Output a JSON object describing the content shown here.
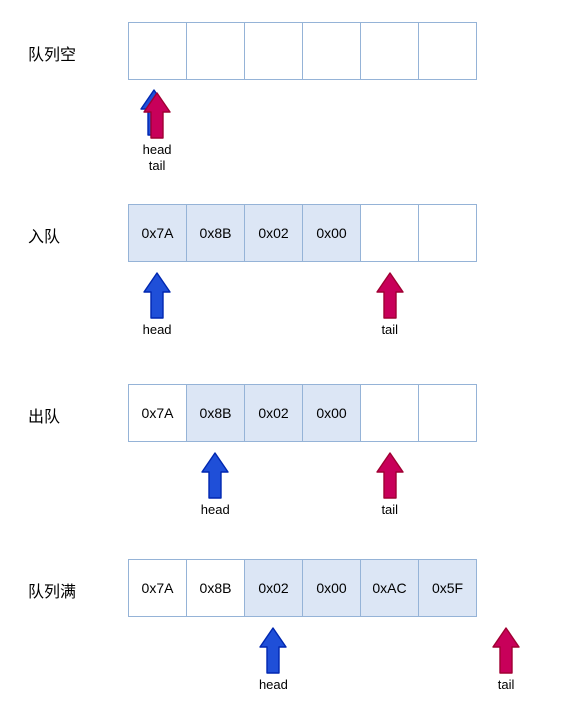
{
  "title": "circular-queue-states",
  "colors": {
    "cell_fill": "#DCE6F5",
    "cell_border": "#95B3D7",
    "head_arrow": "#1F4FD8",
    "tail_arrow": "#C8005A",
    "background": "#FFFFFF",
    "text": "#000000"
  },
  "labels": {
    "head": "head",
    "tail": "tail"
  },
  "rows": [
    {
      "id": "queue-empty",
      "label": "队列空",
      "cells": [
        {
          "value": "",
          "filled": false
        },
        {
          "value": "",
          "filled": false
        },
        {
          "value": "",
          "filled": false
        },
        {
          "value": "",
          "filled": false
        },
        {
          "value": "",
          "filled": false
        },
        {
          "value": "",
          "filled": false
        }
      ],
      "head_index": 0,
      "tail_index": 0,
      "pointers_overlap": true
    },
    {
      "id": "enqueue",
      "label": "入队",
      "cells": [
        {
          "value": "0x7A",
          "filled": true
        },
        {
          "value": "0x8B",
          "filled": true
        },
        {
          "value": "0x02",
          "filled": true
        },
        {
          "value": "0x00",
          "filled": true
        },
        {
          "value": "",
          "filled": false
        },
        {
          "value": "",
          "filled": false
        }
      ],
      "head_index": 0,
      "tail_index": 4,
      "pointers_overlap": false
    },
    {
      "id": "dequeue",
      "label": "出队",
      "cells": [
        {
          "value": "0x7A",
          "filled": false
        },
        {
          "value": "0x8B",
          "filled": true
        },
        {
          "value": "0x02",
          "filled": true
        },
        {
          "value": "0x00",
          "filled": true
        },
        {
          "value": "",
          "filled": false
        },
        {
          "value": "",
          "filled": false
        }
      ],
      "head_index": 1,
      "tail_index": 4,
      "pointers_overlap": false
    },
    {
      "id": "queue-full",
      "label": "队列满",
      "cells": [
        {
          "value": "0x7A",
          "filled": false
        },
        {
          "value": "0x8B",
          "filled": false
        },
        {
          "value": "0x02",
          "filled": true
        },
        {
          "value": "0x00",
          "filled": true
        },
        {
          "value": "0xAC",
          "filled": true
        },
        {
          "value": "0x5F",
          "filled": true
        }
      ],
      "head_index": 2,
      "tail_index": 6,
      "pointers_overlap": false
    }
  ]
}
